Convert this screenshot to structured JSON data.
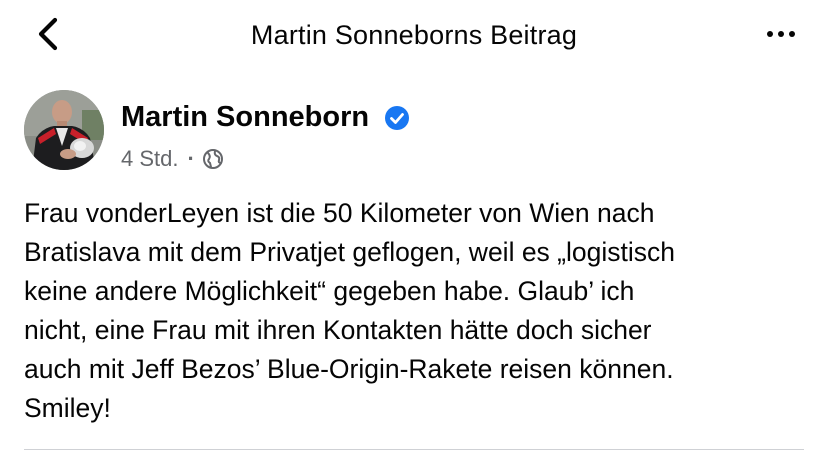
{
  "header": {
    "title": "Martin Sonneborns Beitrag",
    "back_icon": "chevron-left-icon",
    "more_icon": "more-horizontal-icon"
  },
  "post": {
    "author": "Martin Sonneborn",
    "verified": true,
    "time": "4 Std.",
    "separator": "·",
    "audience_icon": "globe-icon",
    "text": "Frau vonderLeyen ist die 50 Kilometer von Wien nach\nBratislava mit dem Privatjet geflogen, weil es „logistisch\nkeine andere Möglichkeit“ gegeben habe. Glaub’ ich\nnicht, eine Frau mit ihren Kontakten hätte doch sicher\nauch mit Jeff Bezos’ Blue-Origin-Rakete reisen können.\nSmiley!"
  },
  "colors": {
    "text": "#050505",
    "secondary_text": "#65676b",
    "verified_badge": "#1877f2",
    "divider": "#cfd1d5",
    "background": "#ffffff"
  }
}
